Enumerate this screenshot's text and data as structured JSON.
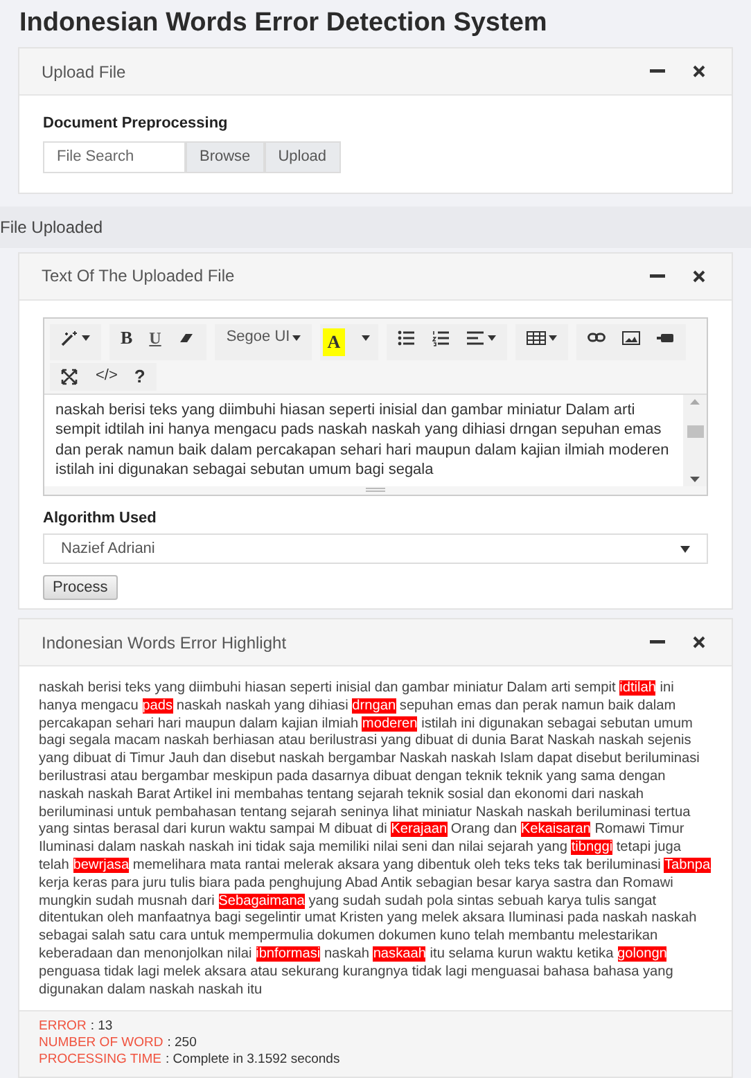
{
  "title": "Indonesian Words Error Detection System",
  "upload_panel": {
    "title": "Upload File",
    "section_label": "Document Preprocessing",
    "file_field": {
      "placeholder": "File Search"
    },
    "buttons": [
      "Browse",
      "Upload"
    ]
  },
  "file_uploaded": {
    "label": "File Uploaded"
  },
  "text_panel": {
    "title": "Text Of The Uploaded File",
    "toolbar": [
      [
        {
          "kind": "magic",
          "caret": true
        }
      ],
      [
        {
          "kind": "bold",
          "label": "B"
        },
        {
          "kind": "underline",
          "label": "U"
        },
        {
          "kind": "eraser"
        }
      ],
      [
        {
          "kind": "font",
          "label": "Segoe UI",
          "caret": true
        }
      ],
      [
        {
          "kind": "color",
          "label": "A"
        },
        {
          "kind": "caret"
        }
      ],
      [
        {
          "kind": "ul"
        },
        {
          "kind": "ol"
        },
        {
          "kind": "align",
          "caret": true
        }
      ],
      [
        {
          "kind": "table",
          "caret": true
        }
      ],
      [
        {
          "kind": "link"
        },
        {
          "kind": "image"
        },
        {
          "kind": "video"
        }
      ],
      [
        {
          "kind": "fullscreen"
        },
        {
          "kind": "code",
          "label": "</>"
        },
        {
          "kind": "help",
          "label": "?"
        }
      ]
    ],
    "editor_text": "naskah berisi teks yang diimbuhi hiasan seperti inisial dan gambar miniatur Dalam arti sempit idtilah ini hanya mengacu pads naskah naskah yang dihiasi drngan sepuhan emas dan perak namun baik dalam percakapan sehari hari maupun dalam kajian ilmiah moderen istilah ini digunakan sebagai sebutan umum bagi segala",
    "algorithm_label": "Algorithm Used",
    "algorithm": "Nazief Adriani",
    "process_button": "Process"
  },
  "highlight_panel": {
    "title": "Indonesian Words Error Highlight",
    "segments": [
      {
        "text": "naskah berisi teks yang diimbuhi hiasan seperti inisial dan gambar miniatur Dalam arti sempit ",
        "error": false
      },
      {
        "text": "idtilah",
        "error": true
      },
      {
        "text": " ini hanya mengacu ",
        "error": false
      },
      {
        "text": "pads",
        "error": true
      },
      {
        "text": " naskah naskah yang dihiasi ",
        "error": false
      },
      {
        "text": "drngan",
        "error": true
      },
      {
        "text": " sepuhan emas dan perak namun baik dalam percakapan sehari hari maupun dalam kajian ilmiah ",
        "error": false
      },
      {
        "text": "moderen",
        "error": true
      },
      {
        "text": " istilah ini digunakan sebagai sebutan umum bagi segala macam naskah berhiasan atau berilustrasi yang dibuat di dunia Barat Naskah naskah sejenis yang dibuat di Timur Jauh dan disebut naskah bergambar Naskah naskah Islam dapat disebut beriluminasi berilustrasi atau bergambar meskipun pada dasarnya dibuat dengan teknik teknik yang sama dengan naskah naskah Barat Artikel ini membahas tentang sejarah teknik sosial dan ekonomi dari naskah beriluminasi untuk pembahasan tentang sejarah seninya lihat miniatur Naskah naskah beriluminasi tertua yang sintas berasal dari kurun waktu sampai M dibuat di ",
        "error": false
      },
      {
        "text": "Kerajaan",
        "error": true
      },
      {
        "text": " Orang dan ",
        "error": false
      },
      {
        "text": "Kekaisaran",
        "error": true
      },
      {
        "text": " Romawi Timur Iluminasi dalam naskah naskah ini tidak saja memiliki nilai seni dan nilai sejarah yang ",
        "error": false
      },
      {
        "text": "tibnggi",
        "error": true
      },
      {
        "text": " tetapi juga telah ",
        "error": false
      },
      {
        "text": "bewrjasa",
        "error": true
      },
      {
        "text": " memelihara mata rantai melerak aksara yang dibentuk oleh teks teks tak beriluminasi ",
        "error": false
      },
      {
        "text": "Tabnpa",
        "error": true
      },
      {
        "text": " kerja keras para juru tulis biara pada penghujung Abad Antik sebagian besar karya sastra dan Romawi mungkin sudah musnah dari ",
        "error": false
      },
      {
        "text": "Sebagaimana",
        "error": true
      },
      {
        "text": " yang sudah sudah pola sintas sebuah karya tulis sangat ditentukan oleh manfaatnya bagi segelintir umat Kristen yang melek aksara Iluminasi pada naskah naskah sebagai salah satu cara untuk mempermulia dokumen dokumen kuno telah membantu melestarikan keberadaan dan menonjolkan nilai ",
        "error": false
      },
      {
        "text": "ibnformasi",
        "error": true
      },
      {
        "text": " naskah ",
        "error": false
      },
      {
        "text": "naskaah",
        "error": true
      },
      {
        "text": " itu selama kurun waktu ketika ",
        "error": false
      },
      {
        "text": "golongn",
        "error": true
      },
      {
        "text": " penguasa tidak lagi melek aksara atau sekurang kurangnya tidak lagi menguasai bahasa bahasa yang digunakan dalam naskah naskah itu",
        "error": false
      }
    ],
    "stats": [
      {
        "label": "ERROR",
        "value": ": 13"
      },
      {
        "label": "NUMBER OF WORD",
        "value": ": 250"
      },
      {
        "label": "PROCESSING TIME",
        "value": ": Complete in 3.1592 seconds"
      }
    ]
  }
}
